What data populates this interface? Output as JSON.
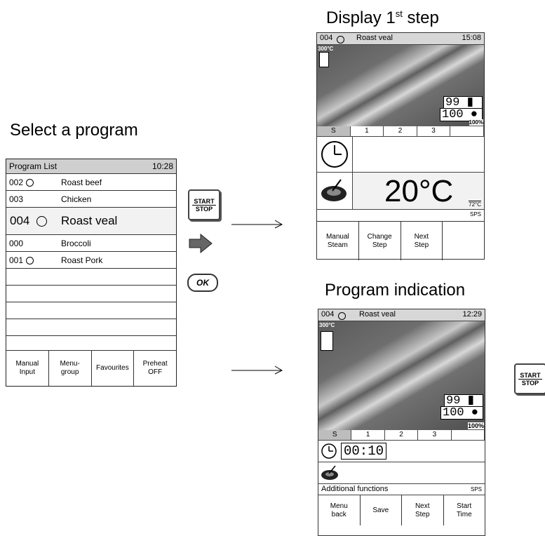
{
  "headings": {
    "select": "Select a program",
    "display_main": "Display 1",
    "display_sup": "st",
    "display_tail": " step",
    "program_indication": "Program indication"
  },
  "program_list": {
    "title": "Program List",
    "time": "10:28",
    "rows": [
      {
        "num": "002",
        "name": "Roast beef",
        "smiley": true
      },
      {
        "num": "003",
        "name": "Chicken",
        "smiley": false
      },
      {
        "num": "004",
        "name": "Roast veal",
        "smiley": true
      },
      {
        "num": "000",
        "name": "Broccoli",
        "smiley": false
      },
      {
        "num": "001",
        "name": "Roast Pork",
        "smiley": true
      }
    ],
    "buttons": [
      "Manual\nInput",
      "Menu-\ngroup",
      "Favourites",
      "Preheat\nOFF"
    ]
  },
  "controls": {
    "start": "START",
    "stop": "STOP",
    "ok": "OK"
  },
  "screen1": {
    "prog_num": "004",
    "prog_name": "Roast veal",
    "time": "15:08",
    "max_temp": "300°C",
    "humidity": "99",
    "temp": "100",
    "percent": "100%",
    "tabs": [
      "S",
      "1",
      "2",
      "3",
      ""
    ],
    "core_temp": "20°C",
    "core_target": "72°C",
    "sps": "SPS",
    "buttons": [
      "Manual\nSteam",
      "Change\nStep",
      "Next\nStep",
      ""
    ]
  },
  "screen2": {
    "prog_num": "004",
    "prog_name": "Roast veal",
    "time": "12:29",
    "max_temp": "300°C",
    "humidity": "99",
    "temp": "100",
    "percent": "100%",
    "tabs": [
      "S",
      "1",
      "2",
      "3",
      ""
    ],
    "timer": "00:10",
    "additional": "Additional functions",
    "sps": "SPS",
    "buttons": [
      "Menu\nback",
      "Save",
      "Next\nStep",
      "Start\nTime"
    ]
  }
}
